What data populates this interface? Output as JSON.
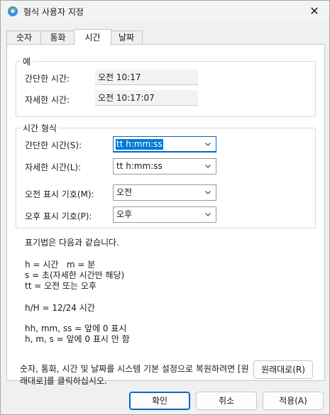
{
  "window": {
    "title": "형식 사용자 지정",
    "close_glyph": "✕"
  },
  "tabs": [
    {
      "label": "숫자"
    },
    {
      "label": "통화"
    },
    {
      "label": "시간",
      "active": true
    },
    {
      "label": "날짜"
    }
  ],
  "example": {
    "legend": "예",
    "short_label": "간단한 시간:",
    "short_value": "오전 10:17",
    "long_label": "자세한 시간:",
    "long_value": "오전 10:17:07"
  },
  "time_format": {
    "legend": "시간 형식",
    "short_label": "간단한 시간(S):",
    "short_value": "tt h:mm:ss",
    "long_label": "자세한 시간(L):",
    "long_value": "tt h:mm:ss",
    "am_label": "오전 표시 기호(M):",
    "am_value": "오전",
    "pm_label": "오후 표시 기호(P):",
    "pm_value": "오후"
  },
  "notation": {
    "intro": "표기법은 다음과 같습니다.",
    "line_h": "h = 시간   m = 분",
    "line_s": "s = 초(자세한 시간만 해당)",
    "line_tt": "tt = 오전 또는 오후",
    "line_hH": "h/H = 12/24 시간",
    "line_pad": "hh, mm, ss = 앞에 0 표시",
    "line_nopad": "h, m, s = 앞에 0 표시 안 함"
  },
  "restore": {
    "text": "숫자, 통화, 시간 및 날짜를 시스템 기본 설정으로 복원하려면 [원래대로]를 클릭하십시오.",
    "button": "원래대로(R)"
  },
  "footer": {
    "ok": "확인",
    "cancel": "취소",
    "apply": "적용(A)"
  },
  "colors": {
    "accent": "#0067c0",
    "selection": "#0078d7"
  }
}
